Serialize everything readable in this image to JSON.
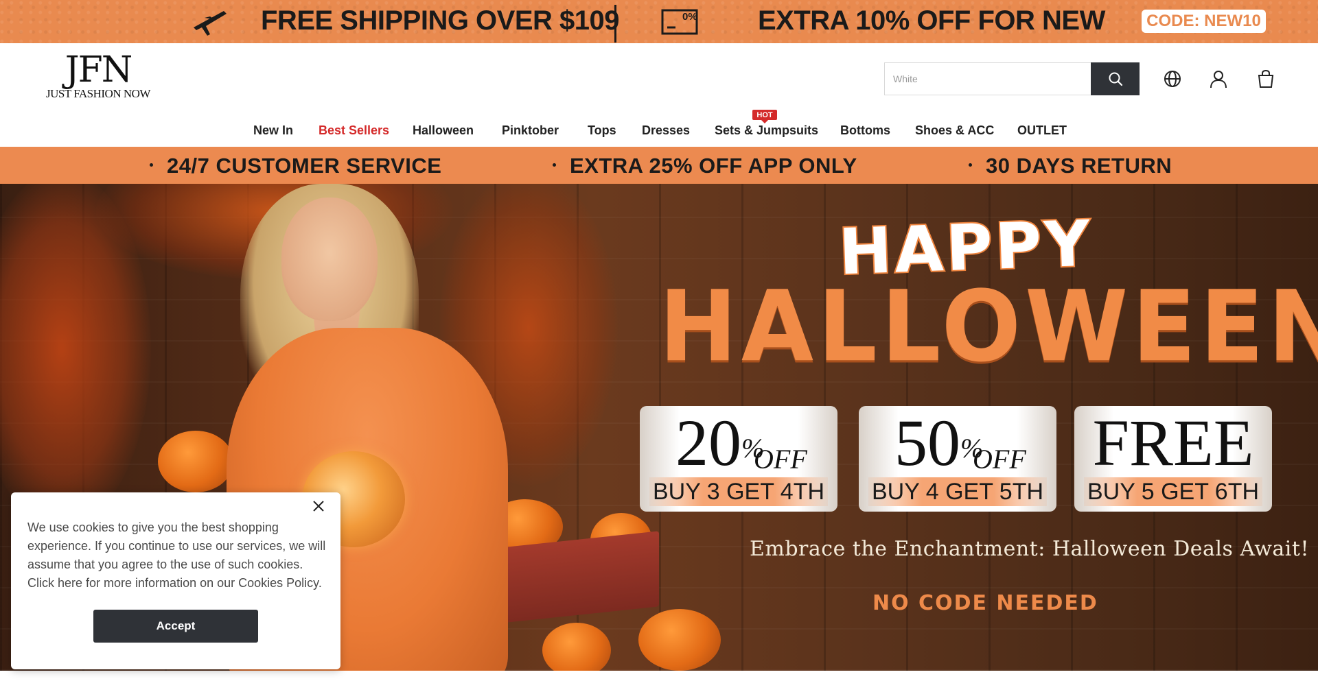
{
  "promo_strip": {
    "shipping_text": "FREE SHIPPING OVER $109",
    "discount_text": "EXTRA 10% OFF FOR NEW",
    "code_text": "CODE: NEW10",
    "icons": [
      "airplane-icon",
      "coupon-icon"
    ],
    "background_color": "#e98a4f"
  },
  "header": {
    "logo_mark": "JFN",
    "logo_subtitle": "JUST FASHION NOW",
    "search": {
      "placeholder": "White",
      "value": ""
    },
    "icons": [
      "search-icon",
      "globe-icon",
      "user-icon",
      "shopping-bag-icon"
    ]
  },
  "nav": {
    "items": [
      {
        "label": "New In"
      },
      {
        "label": "Best Sellers",
        "color": "#d42a2a"
      },
      {
        "label": "Halloween"
      },
      {
        "label": "Pinktober"
      },
      {
        "label": "Tops"
      },
      {
        "label": "Dresses"
      },
      {
        "label": "Sets & Jumpsuits",
        "badge": "HOT"
      },
      {
        "label": "Bottoms"
      },
      {
        "label": "Shoes & ACC"
      },
      {
        "label": "OUTLET"
      }
    ]
  },
  "service_strip": {
    "items": [
      "24/7 CUSTOMER SERVICE",
      "EXTRA 25% OFF APP ONLY",
      "30 DAYS RETURN"
    ],
    "background_color": "#ec8a50"
  },
  "hero": {
    "headline_top": "HAPPY",
    "headline_main": "HALLOWEEN",
    "deals": [
      {
        "big": "20",
        "pct": "%",
        "off": "OFF",
        "condition": "BUY 3 GET 4TH"
      },
      {
        "big": "50",
        "pct": "%",
        "off": "OFF",
        "condition": "BUY 4 GET 5TH"
      },
      {
        "big": "FREE",
        "condition": "BUY 5 GET 6TH"
      }
    ],
    "tagline": "Embrace the Enchantment: Halloween Deals Await!",
    "note": "NO CODE NEEDED",
    "accent_color": "#f18b47"
  },
  "cookie_banner": {
    "text": "We use cookies to give you the best shopping experience. If you continue to use our services, we will assume that you agree to the use of such cookies. Click here for more information on our Cookies Policy.",
    "accept_label": "Accept"
  }
}
